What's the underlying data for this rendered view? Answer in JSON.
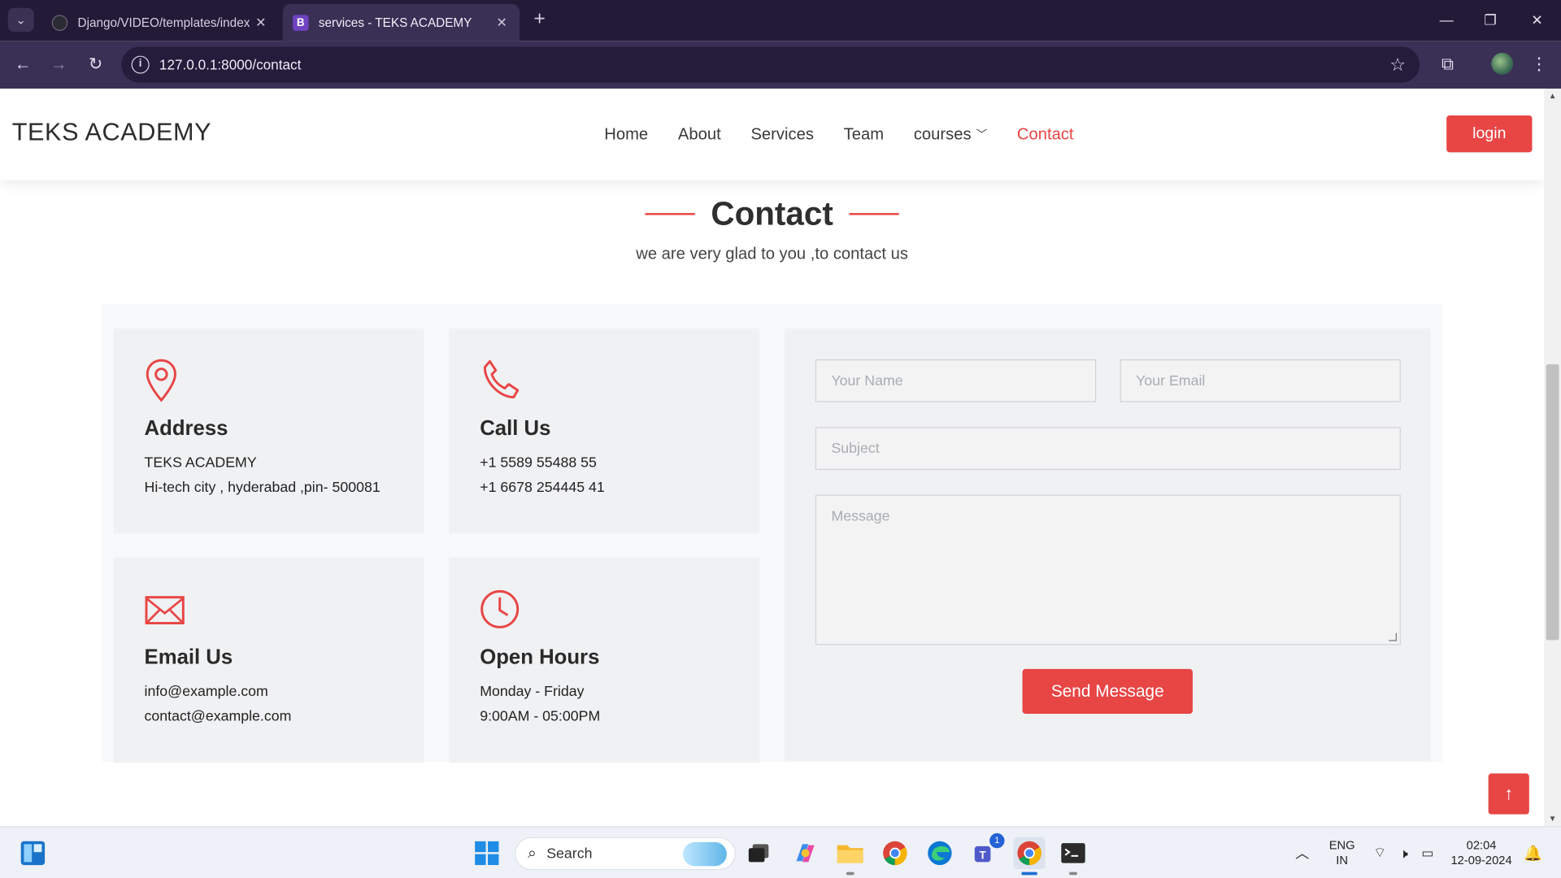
{
  "browser": {
    "tabs": [
      {
        "title": "Django/VIDEO/templates/index",
        "active": false
      },
      {
        "title": "services - TEKS ACADEMY",
        "active": true
      }
    ],
    "new_tab": "+",
    "url": "127.0.0.1:8000/contact"
  },
  "site": {
    "logo": "TEKS ACADEMY",
    "nav": [
      {
        "label": "Home"
      },
      {
        "label": "About"
      },
      {
        "label": "Services"
      },
      {
        "label": "Team"
      },
      {
        "label": "courses"
      },
      {
        "label": "Contact"
      }
    ],
    "login_label": "login",
    "section_title": "Contact",
    "section_subtitle": "we are very glad to you ,to contact us",
    "info_boxes": [
      {
        "icon": "location-pin-icon",
        "title": "Address",
        "lines": [
          "TEKS ACADEMY",
          "Hi-tech city , hyderabad ,pin- 500081"
        ]
      },
      {
        "icon": "phone-icon",
        "title": "Call Us",
        "lines": [
          "+1 5589 55488 55",
          "+1 6678 254445 41"
        ]
      },
      {
        "icon": "envelope-icon",
        "title": "Email Us",
        "lines": [
          "info@example.com",
          "contact@example.com"
        ]
      },
      {
        "icon": "clock-icon",
        "title": "Open Hours",
        "lines": [
          "Monday - Friday",
          "9:00AM - 05:00PM"
        ]
      }
    ],
    "form": {
      "name_placeholder": "Your Name",
      "email_placeholder": "Your Email",
      "subject_placeholder": "Subject",
      "message_placeholder": "Message",
      "submit_label": "Send Message"
    },
    "accent_color": "#e84545"
  },
  "taskbar": {
    "search_label": "Search",
    "teams_badge": "1",
    "lang_line1": "ENG",
    "lang_line2": "IN",
    "time": "02:04",
    "date": "12-09-2024"
  }
}
